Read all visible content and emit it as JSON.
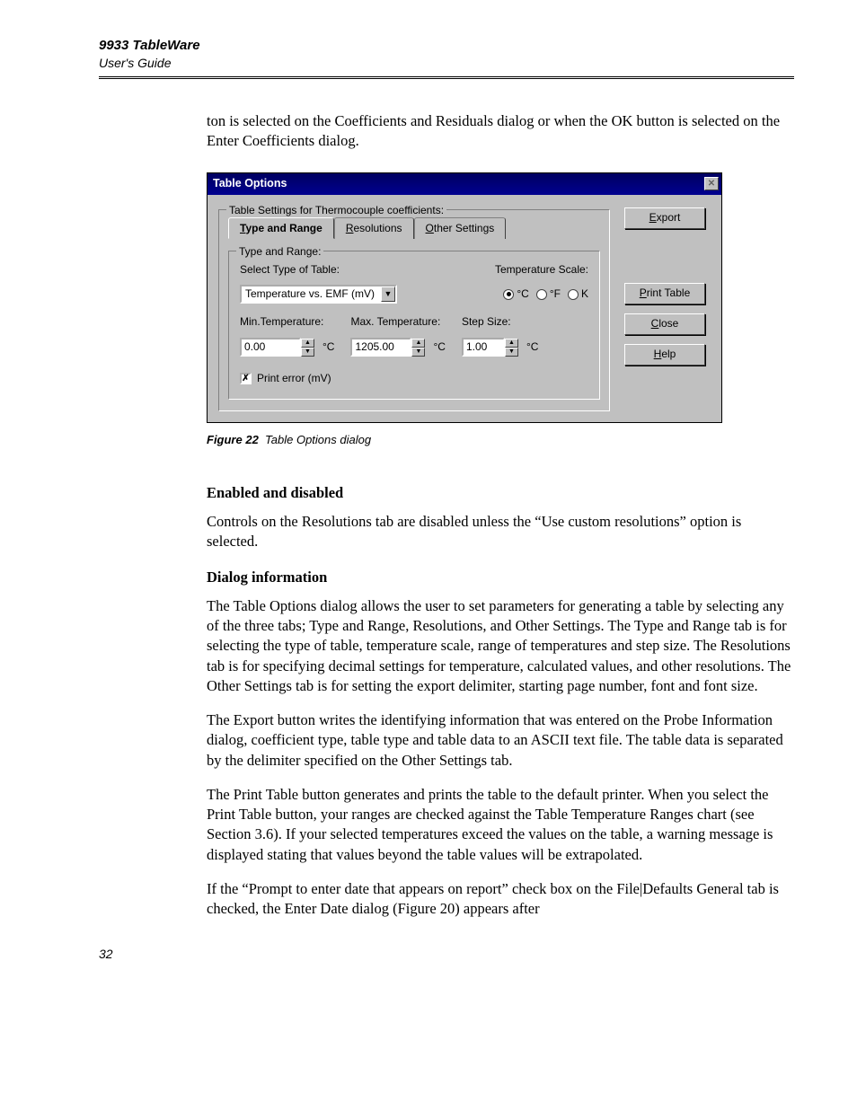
{
  "header": {
    "title": "9933 TableWare",
    "subtitle": "User's Guide"
  },
  "lead": "ton is selected on the Coefficients and Residuals dialog or when the OK button is selected on the Enter Coefficients dialog.",
  "dialog": {
    "title": "Table Options",
    "groupbox_label": "Table Settings for Thermocouple coefficients:",
    "tabs": {
      "type_and_range": "Type and Range",
      "type_and_range_key": "T",
      "resolutions": "Resolutions",
      "resolutions_key": "R",
      "other_settings": "Other Settings",
      "other_settings_key": "O"
    },
    "inner": {
      "legend": "Type and Range:",
      "select_type_label": "Select Type of Table:",
      "combo_value": "Temperature vs. EMF (mV)",
      "temp_scale_label": "Temperature Scale:",
      "radio_c": "°C",
      "radio_f": "°F",
      "radio_k": "K",
      "min_label": "Min.Temperature:",
      "min_val": "0.00",
      "max_label": "Max. Temperature:",
      "max_val": "1205.00",
      "step_label": "Step Size:",
      "step_val": "1.00",
      "unit": "°C",
      "chk_label": "Print error (mV)"
    },
    "buttons": {
      "export": "Export",
      "export_key": "E",
      "print": "Print Table",
      "print_key": "P",
      "close": "Close",
      "close_key": "C",
      "help": "Help",
      "help_key": "H"
    }
  },
  "figure": {
    "bold": "Figure 22",
    "italic": "Table Options dialog"
  },
  "sections": {
    "enabled_h": "Enabled and disabled",
    "enabled_p": "Controls on the Resolutions tab are disabled unless the “Use custom resolutions” option is selected.",
    "info_h": "Dialog information",
    "info_p1": "The Table Options dialog allows the user to set parameters for generating a table by selecting any of the three tabs; Type and Range, Resolutions, and Other Settings. The Type and Range tab is for selecting the type of table, temperature scale, range of temperatures and step size. The Resolutions tab is for specifying decimal settings for temperature, calculated values, and other resolutions. The Other Settings tab is for setting the export delimiter, starting page number, font and font size.",
    "info_p2": "The Export button writes the identifying information that was entered on the Probe Information dialog, coefficient type, table type and table data to an ASCII text file. The table data is separated by the delimiter specified on the Other Settings tab.",
    "info_p3": "The Print Table button generates and prints the table to the default printer. When you select the Print Table button, your ranges are checked against the Table Temperature Ranges chart (see Section 3.6). If your selected temperatures exceed the values on the table, a warning message is displayed stating that values beyond the table values will be extrapolated.",
    "info_p4": " If the “Prompt to enter date that appears on report” check box on the File|Defaults General tab is checked, the Enter Date dialog (Figure 20) appears after"
  },
  "page_number": "32"
}
